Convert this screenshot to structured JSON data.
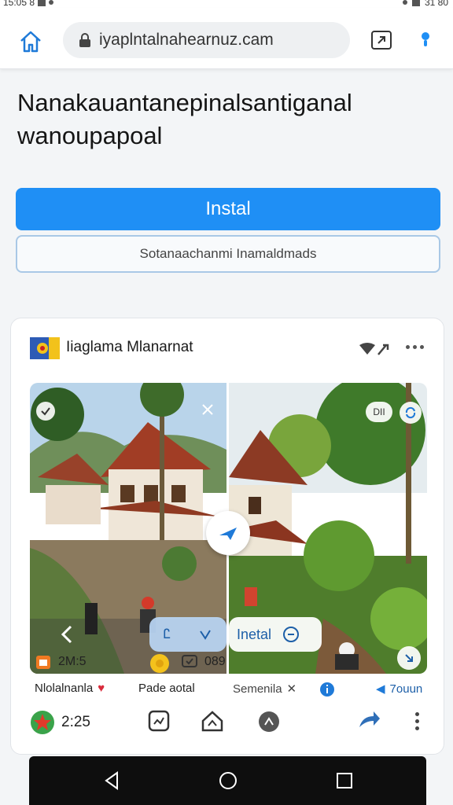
{
  "status_bar": {
    "time": "15:05 8",
    "battery": "31 80"
  },
  "browser": {
    "url": "iyaplntalnahearnuz.cam"
  },
  "page": {
    "headline_line1": "Nanakauantanepinalsantiganal",
    "headline_line2": "wanoupapoal",
    "primary_button": "Instal",
    "secondary_button": "Sotanaachanmi Inamaldmads"
  },
  "card": {
    "title": "Iiaglama Mlanarnat",
    "hd_badge": "DII",
    "speed_label": "Ꮭ",
    "install_overlay": "Inetal",
    "stats": [
      {
        "icon": "calendar-icon",
        "value": "2M:5"
      },
      {
        "icon": "coin-icon",
        "value": ""
      },
      {
        "icon": "chat-icon",
        "value": "089"
      }
    ],
    "labels": [
      {
        "text": "Nlolalnanla"
      },
      {
        "text": "Pade aotal"
      },
      {
        "text": "Semenila"
      },
      {
        "text": "7ouun"
      }
    ],
    "rating": "2:25"
  },
  "colors": {
    "accent": "#1f8ff5",
    "outline": "#a9c8e6"
  }
}
